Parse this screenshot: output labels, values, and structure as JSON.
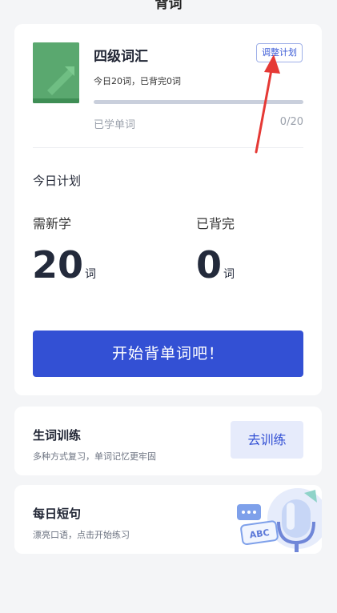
{
  "header": {
    "title": "背词"
  },
  "book": {
    "title": "四级词汇",
    "subtitle": "今日20词，已背完0词",
    "adjust_label": "调整计划",
    "progress_fraction": 0,
    "learned_label": "已学单词",
    "learned_count": "0/20",
    "cover_color": "#5aa86f"
  },
  "plan": {
    "title": "今日计划",
    "new_label": "需新学",
    "new_value": "20",
    "done_label": "已背完",
    "done_value": "0",
    "unit": "词"
  },
  "start_button": {
    "label": "开始背单词吧！",
    "color": "#3350d4"
  },
  "training": {
    "title": "生词训练",
    "subtitle": "多种方式复习，单词记忆更牢固",
    "button_label": "去训练"
  },
  "daily": {
    "title": "每日短句",
    "subtitle": "漂亮口语，点击开始练习",
    "illustration_text": "ABC"
  },
  "annotation": {
    "arrow_color": "#e53935"
  }
}
